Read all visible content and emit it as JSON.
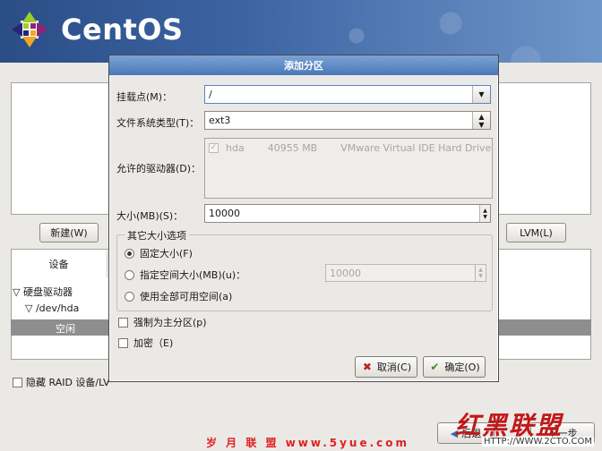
{
  "brand": {
    "name": "CentOS"
  },
  "background": {
    "new_button": "新建(W)",
    "lvm_button": "LVM(L)",
    "device_column": "设备",
    "tree": {
      "hard_drives": "硬盘驱动器",
      "dev": "/dev/hda",
      "free": "空闲"
    },
    "raid_checkbox": "隐藏 RAID 设备/LV",
    "back_button": "后退",
    "next_button": "下一步"
  },
  "dialog": {
    "title": "添加分区",
    "mount_label": "挂载点(M)：",
    "mount_value": "/",
    "fs_label": "文件系统类型(T)：",
    "fs_value": "ext3",
    "drives_label": "允许的驱动器(D)：",
    "drive": {
      "name": "hda",
      "size": "40955 MB",
      "model": "VMware Virtual IDE Hard Drive",
      "checked": true
    },
    "size_label": "大小(MB)(S)：",
    "size_value": "10000",
    "other_options_title": "其它大小选项",
    "opt_fixed": "固定大小(F)",
    "opt_upto": "指定空间大小(MB)(u)：",
    "opt_upto_value": "10000",
    "opt_fill": "使用全部可用空间(a)",
    "selected_option": "fixed",
    "force_primary": "强制为主分区(p)",
    "encrypt": "加密（E)",
    "cancel_button": "取消(C)",
    "ok_button": "确定(O)"
  },
  "watermarks": {
    "bottom": "岁 月 联 盟  www.5yue.com",
    "right": "红黑联盟",
    "url": "HTTP://WWW.2CTO.COM"
  },
  "colors": {
    "banner": "#3c64a3",
    "titlebar": "#4a78b8",
    "window_bg": "#ebe9e6"
  }
}
